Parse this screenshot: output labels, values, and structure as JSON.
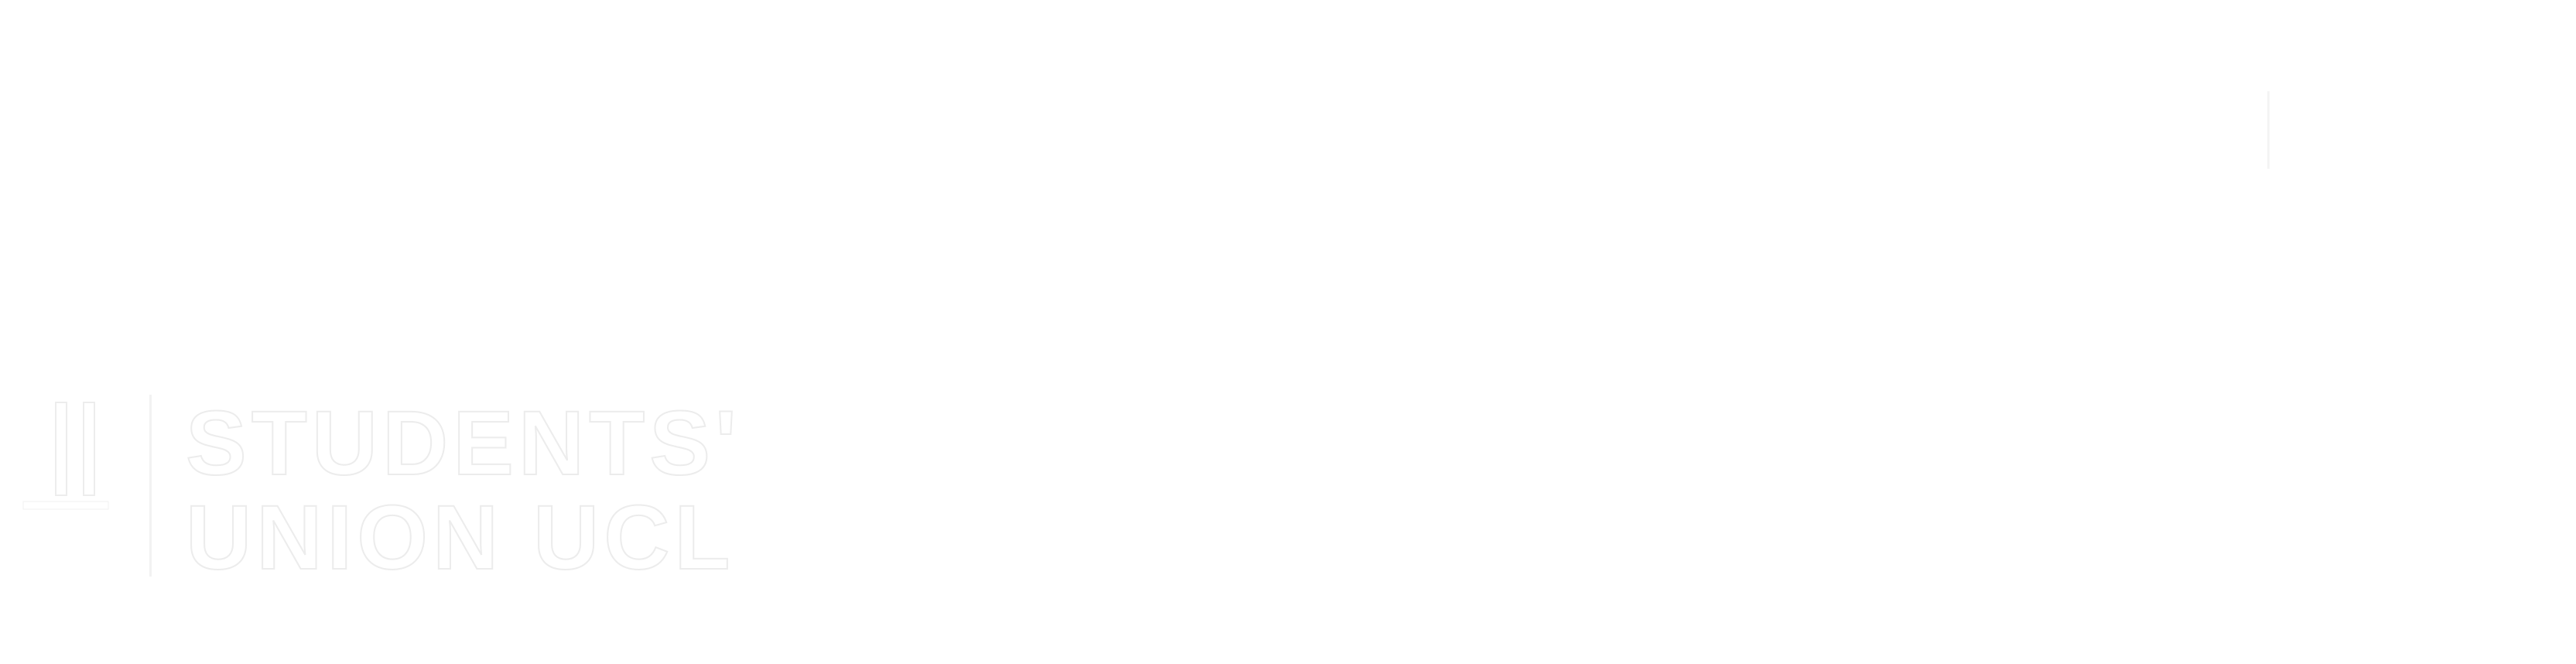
{
  "logo": {
    "line1": "STUDENTS'",
    "line2": "UNION UCL"
  },
  "colors": {
    "background": "#ffffff",
    "logo_fill": "#ffffff",
    "logo_outline": "#ececec"
  }
}
